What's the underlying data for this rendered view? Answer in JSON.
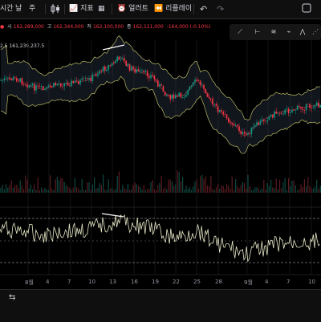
{
  "toolbar": {
    "interval": "시간",
    "day": "날",
    "week": "주",
    "indicator_label": "지표",
    "alert_label": "얼러트",
    "replay_label": "리플레이"
  },
  "ohlc": {
    "open_label": "시",
    "open": "162,289,000",
    "high_label": "고",
    "high": "162,344,000",
    "low_label": "저",
    "low": "162,100,000",
    "close_label": "종",
    "close": "162,121,000",
    "change": "-164,000 (-0.10%)"
  },
  "bb_values": "2.5  161,239,237.5",
  "xaxis_labels": [
    {
      "text": "8월"
    },
    {
      "text": "4"
    },
    {
      "text": "7"
    },
    {
      "text": "10"
    },
    {
      "text": "13"
    },
    {
      "text": "16"
    },
    {
      "text": "19"
    },
    {
      "text": "22"
    },
    {
      "text": "25"
    },
    {
      "text": "28"
    },
    {
      "text": "9월"
    },
    {
      "text": "4"
    },
    {
      "text": "7"
    },
    {
      "text": "10"
    }
  ],
  "colors": {
    "up": "#089981",
    "down": "#f23645",
    "band": "#d6d66b",
    "rsi": "#e8e8c8"
  }
}
